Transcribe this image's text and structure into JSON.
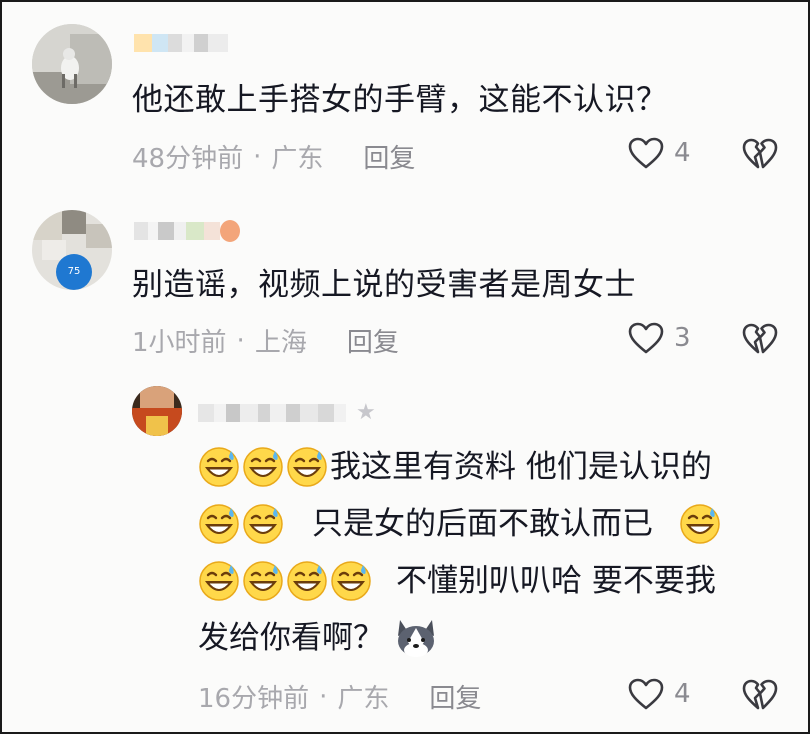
{
  "comments": [
    {
      "text": "他还敢上手搭女的手臂，这能不认识？",
      "time": "48分钟前",
      "location": "广东",
      "reply_label": "回复",
      "likes": "4"
    },
    {
      "text": "别造谣，视频上说的受害者是周女士",
      "time": "1小时前",
      "location": "上海",
      "reply_label": "回复",
      "likes": "3",
      "avatar_badge": "75"
    }
  ],
  "reply": {
    "lines": [
      "我这里有资料  他们是认识的",
      "只是女的后面不敢认而已",
      "不懂别叭叭哈  要不要我",
      "发给你看啊？"
    ],
    "time": "16分钟前",
    "location": "广东",
    "reply_label": "回复",
    "likes": "4"
  },
  "meta_separator": "·",
  "icons": {
    "like": "heart-outline-icon",
    "dislike": "broken-heart-icon",
    "emoji": "grinning-sweat-emoji",
    "sticker": "husky-face-sticker",
    "star": "star-icon"
  }
}
